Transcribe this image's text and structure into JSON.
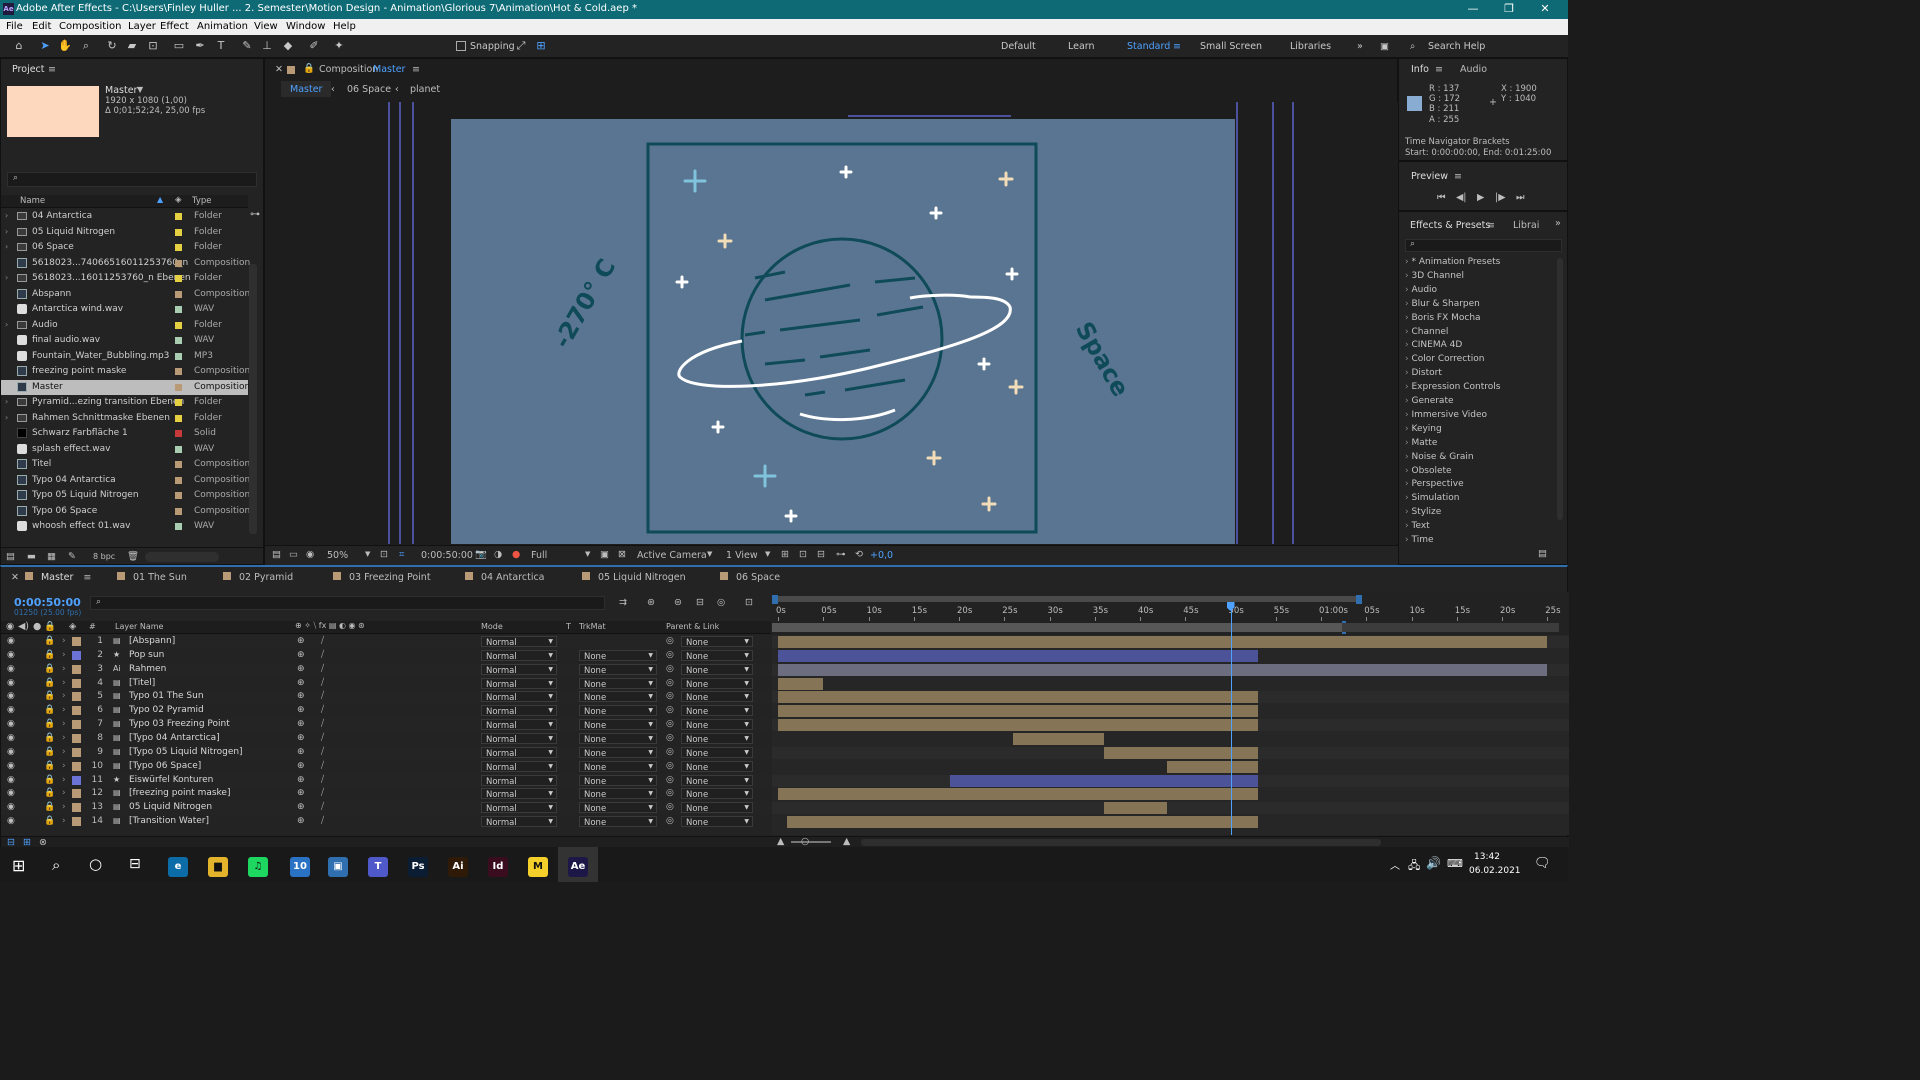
{
  "window": {
    "title": "Adobe After Effects - C:\\Users\\Finley Huller ... 2. Semester\\Motion Design - Animation\\Glorious 7\\Animation\\Hot & Cold.aep *",
    "app_icon": "Ae"
  },
  "menu": [
    "File",
    "Edit",
    "Composition",
    "Layer",
    "Effect",
    "Animation",
    "View",
    "Window",
    "Help"
  ],
  "toolbar": {
    "snapping": "Snapping",
    "workspaces": [
      "Default",
      "Learn",
      "Standard",
      "Small Screen",
      "Libraries"
    ],
    "active_workspace": "Standard",
    "search_placeholder": "Search Help"
  },
  "project": {
    "tab": "Project",
    "selected": {
      "name": "Master",
      "res": "1920 x 1080 (1,00)",
      "dur": "Δ 0;01;52;24, 25,00 fps"
    },
    "col_name": "Name",
    "col_type": "Type",
    "items": [
      {
        "name": "04 Antarctica",
        "type": "Folder",
        "color": "#e4d042",
        "kind": "folder"
      },
      {
        "name": "05 Liquid Nitrogen",
        "type": "Folder",
        "color": "#e4d042",
        "kind": "folder"
      },
      {
        "name": "06 Space",
        "type": "Folder",
        "color": "#e4d042",
        "kind": "folder"
      },
      {
        "name": "5618023...74066516011253760_n",
        "type": "Composition",
        "color": "#b89a76",
        "kind": "comp"
      },
      {
        "name": "5618023...16011253760_n Ebenen",
        "type": "Folder",
        "color": "#e4d042",
        "kind": "folder"
      },
      {
        "name": "Abspann",
        "type": "Composition",
        "color": "#b89a76",
        "kind": "comp"
      },
      {
        "name": "Antarctica wind.wav",
        "type": "WAV",
        "color": "#a8cdb0",
        "kind": "audio"
      },
      {
        "name": "Audio",
        "type": "Folder",
        "color": "#e4d042",
        "kind": "folder"
      },
      {
        "name": "final audio.wav",
        "type": "WAV",
        "color": "#a8cdb0",
        "kind": "audio"
      },
      {
        "name": "Fountain_Water_Bubbling.mp3",
        "type": "MP3",
        "color": "#a8cdb0",
        "kind": "audio"
      },
      {
        "name": "freezing point maske",
        "type": "Composition",
        "color": "#b89a76",
        "kind": "comp"
      },
      {
        "name": "Master",
        "type": "Composition",
        "color": "#b89a76",
        "kind": "comp",
        "selected": true
      },
      {
        "name": "Pyramid...ezing transition Ebenen",
        "type": "Folder",
        "color": "#e4d042",
        "kind": "folder"
      },
      {
        "name": "Rahmen Schnittmaske Ebenen",
        "type": "Folder",
        "color": "#e4d042",
        "kind": "folder"
      },
      {
        "name": "Schwarz Farbfläche 1",
        "type": "Solid",
        "color": "#c83a3a",
        "kind": "solid"
      },
      {
        "name": "splash effect.wav",
        "type": "WAV",
        "color": "#a8cdb0",
        "kind": "audio"
      },
      {
        "name": "Titel",
        "type": "Composition",
        "color": "#b89a76",
        "kind": "comp"
      },
      {
        "name": "Typo 04 Antarctica",
        "type": "Composition",
        "color": "#b89a76",
        "kind": "comp"
      },
      {
        "name": "Typo 05 Liquid Nitrogen",
        "type": "Composition",
        "color": "#b89a76",
        "kind": "comp"
      },
      {
        "name": "Typo 06 Space",
        "type": "Composition",
        "color": "#b89a76",
        "kind": "comp"
      },
      {
        "name": "whoosh effect 01.wav",
        "type": "WAV",
        "color": "#a8cdb0",
        "kind": "audio"
      }
    ],
    "bpc": "8 bpc"
  },
  "composition": {
    "tab_prefix": "Composition",
    "tab_name": "Master",
    "crumbs": [
      "Master",
      "06 Space",
      "planet"
    ],
    "canvas": {
      "bg": "#5a7591",
      "line": "#0e4a58",
      "star_cream": "#f3dcb8",
      "star_blue": "#7fc3dc",
      "left_text": "-270° C",
      "right_text": "Space"
    },
    "footer": {
      "zoom": "50%",
      "time": "0:00:50:00",
      "resolution": "Full",
      "camera": "Active Camera",
      "views": "1 View",
      "exposure": "+0,0"
    }
  },
  "info": {
    "tab": "Info",
    "tab2": "Audio",
    "r": "R : 137",
    "g": "G : 172",
    "b": "B : 211",
    "a": "A : 255",
    "x": "X : 1900",
    "y": "Y : 1040",
    "swatch": "#89acd3",
    "nav_title": "Time Navigator Brackets",
    "nav_range": "Start: 0:00:00:00, End: 0:01:25:00"
  },
  "preview": {
    "tab": "Preview"
  },
  "effects": {
    "tab": "Effects & Presets",
    "tab2": "Librai",
    "items": [
      "* Animation Presets",
      "3D Channel",
      "Audio",
      "Blur & Sharpen",
      "Boris FX Mocha",
      "Channel",
      "CINEMA 4D",
      "Color Correction",
      "Distort",
      "Expression Controls",
      "Generate",
      "Immersive Video",
      "Keying",
      "Matte",
      "Noise & Grain",
      "Obsolete",
      "Perspective",
      "Simulation",
      "Stylize",
      "Text",
      "Time"
    ]
  },
  "timeline": {
    "tabs": [
      {
        "name": "Master",
        "color": "#b89a76",
        "active": true
      },
      {
        "name": "01 The Sun",
        "color": "#b89a76"
      },
      {
        "name": "02 Pyramid",
        "color": "#b89a76"
      },
      {
        "name": "03 Freezing Point",
        "color": "#b89a76"
      },
      {
        "name": "04 Antarctica",
        "color": "#b89a76"
      },
      {
        "name": "05 Liquid Nitrogen",
        "color": "#b89a76"
      },
      {
        "name": "06 Space",
        "color": "#b89a76"
      }
    ],
    "timecode": "0:00:50:00",
    "frames": "01250 (25.00 fps)",
    "col_layer": "Layer Name",
    "col_mode": "Mode",
    "col_t": "T",
    "col_trkmat": "TrkMat",
    "col_parent": "Parent & Link",
    "ruler": [
      "0s",
      "05s",
      "10s",
      "15s",
      "20s",
      "25s",
      "30s",
      "35s",
      "40s",
      "45s",
      "50s",
      "55s",
      "01:00s",
      "05s",
      "10s",
      "15s",
      "20s",
      "25s"
    ],
    "playhead_sec": 50,
    "layers": [
      {
        "num": "1",
        "name": "[Abspann]",
        "color": "#b89a76",
        "icon": "comp",
        "mode": "Normal",
        "trk": "",
        "parent": "None",
        "start": 0,
        "end": 85,
        "bar": "#857456"
      },
      {
        "num": "2",
        "name": "Pop sun",
        "color": "#6b74d6",
        "icon": "star",
        "mode": "Normal",
        "trk": "None",
        "parent": "None",
        "start": 0,
        "end": 53,
        "bar": "#4d5398"
      },
      {
        "num": "3",
        "name": "Rahmen",
        "color": "#b89a76",
        "icon": "ai",
        "mode": "Normal",
        "trk": "None",
        "parent": "None",
        "start": 0,
        "end": 85,
        "bar": "#6d6d80"
      },
      {
        "num": "4",
        "name": "[Titel]",
        "color": "#b89a76",
        "icon": "comp",
        "mode": "Normal",
        "trk": "None",
        "parent": "None",
        "start": 0,
        "end": 5,
        "bar": "#857456"
      },
      {
        "num": "5",
        "name": "Typo 01 The Sun",
        "color": "#b89a76",
        "icon": "comp",
        "mode": "Normal",
        "trk": "None",
        "parent": "None",
        "start": 0,
        "end": 53,
        "bar": "#857456"
      },
      {
        "num": "6",
        "name": "Typo 02 Pyramid",
        "color": "#b89a76",
        "icon": "comp",
        "mode": "Normal",
        "trk": "None",
        "parent": "None",
        "start": 0,
        "end": 53,
        "bar": "#857456"
      },
      {
        "num": "7",
        "name": "Typo 03 Freezing Point",
        "color": "#b89a76",
        "icon": "comp",
        "mode": "Normal",
        "trk": "None",
        "parent": "None",
        "start": 0,
        "end": 53,
        "bar": "#857456"
      },
      {
        "num": "8",
        "name": "[Typo 04 Antarctica]",
        "color": "#b89a76",
        "icon": "comp",
        "mode": "Normal",
        "trk": "None",
        "parent": "None",
        "start": 26,
        "end": 36,
        "bar": "#857456"
      },
      {
        "num": "9",
        "name": "[Typo 05 Liquid Nitrogen]",
        "color": "#b89a76",
        "icon": "comp",
        "mode": "Normal",
        "trk": "None",
        "parent": "None",
        "start": 36,
        "end": 53,
        "bar": "#857456"
      },
      {
        "num": "10",
        "name": "[Typo 06 Space]",
        "color": "#b89a76",
        "icon": "comp",
        "mode": "Normal",
        "trk": "None",
        "parent": "None",
        "start": 43,
        "end": 53,
        "bar": "#857456"
      },
      {
        "num": "11",
        "name": "Eiswürfel Konturen",
        "color": "#6b74d6",
        "icon": "star",
        "mode": "Normal",
        "trk": "None",
        "parent": "None",
        "start": 19,
        "end": 53,
        "bar": "#4d5398"
      },
      {
        "num": "12",
        "name": "[freezing point maske]",
        "color": "#b89a76",
        "icon": "comp",
        "mode": "Normal",
        "trk": "None",
        "parent": "None",
        "start": 0,
        "end": 53,
        "bar": "#857456"
      },
      {
        "num": "13",
        "name": "05 Liquid Nitrogen",
        "color": "#b89a76",
        "icon": "comp",
        "mode": "Normal",
        "trk": "None",
        "parent": "None",
        "start": 36,
        "end": 43,
        "bar": "#857456"
      },
      {
        "num": "14",
        "name": "[Transition Water]",
        "color": "#b89a76",
        "icon": "comp",
        "mode": "Normal",
        "trk": "None",
        "parent": "None",
        "start": 1,
        "end": 53,
        "bar": "#857456"
      }
    ]
  },
  "taskbar": {
    "time": "13:42",
    "date": "06.02.2021",
    "apps": [
      {
        "name": "edge",
        "label": "e",
        "bg": "#0b6ca8"
      },
      {
        "name": "explorer",
        "label": "▆",
        "bg": "#e3b32b"
      },
      {
        "name": "spotify",
        "label": "♫",
        "bg": "#1ed760"
      },
      {
        "name": "mail",
        "label": "10",
        "bg": "#2a73c4"
      },
      {
        "name": "store",
        "label": "▣",
        "bg": "#2f6fb0"
      },
      {
        "name": "teams",
        "label": "T",
        "bg": "#5059c9"
      },
      {
        "name": "photoshop",
        "label": "Ps",
        "bg": "#0b1d33"
      },
      {
        "name": "illustrator",
        "label": "Ai",
        "bg": "#2f1a08"
      },
      {
        "name": "indesign",
        "label": "Id",
        "bg": "#3a0d1e"
      },
      {
        "name": "miro",
        "label": "M",
        "bg": "#f5d02a"
      },
      {
        "name": "aftereffects",
        "label": "Ae",
        "bg": "#1c1746"
      }
    ]
  }
}
